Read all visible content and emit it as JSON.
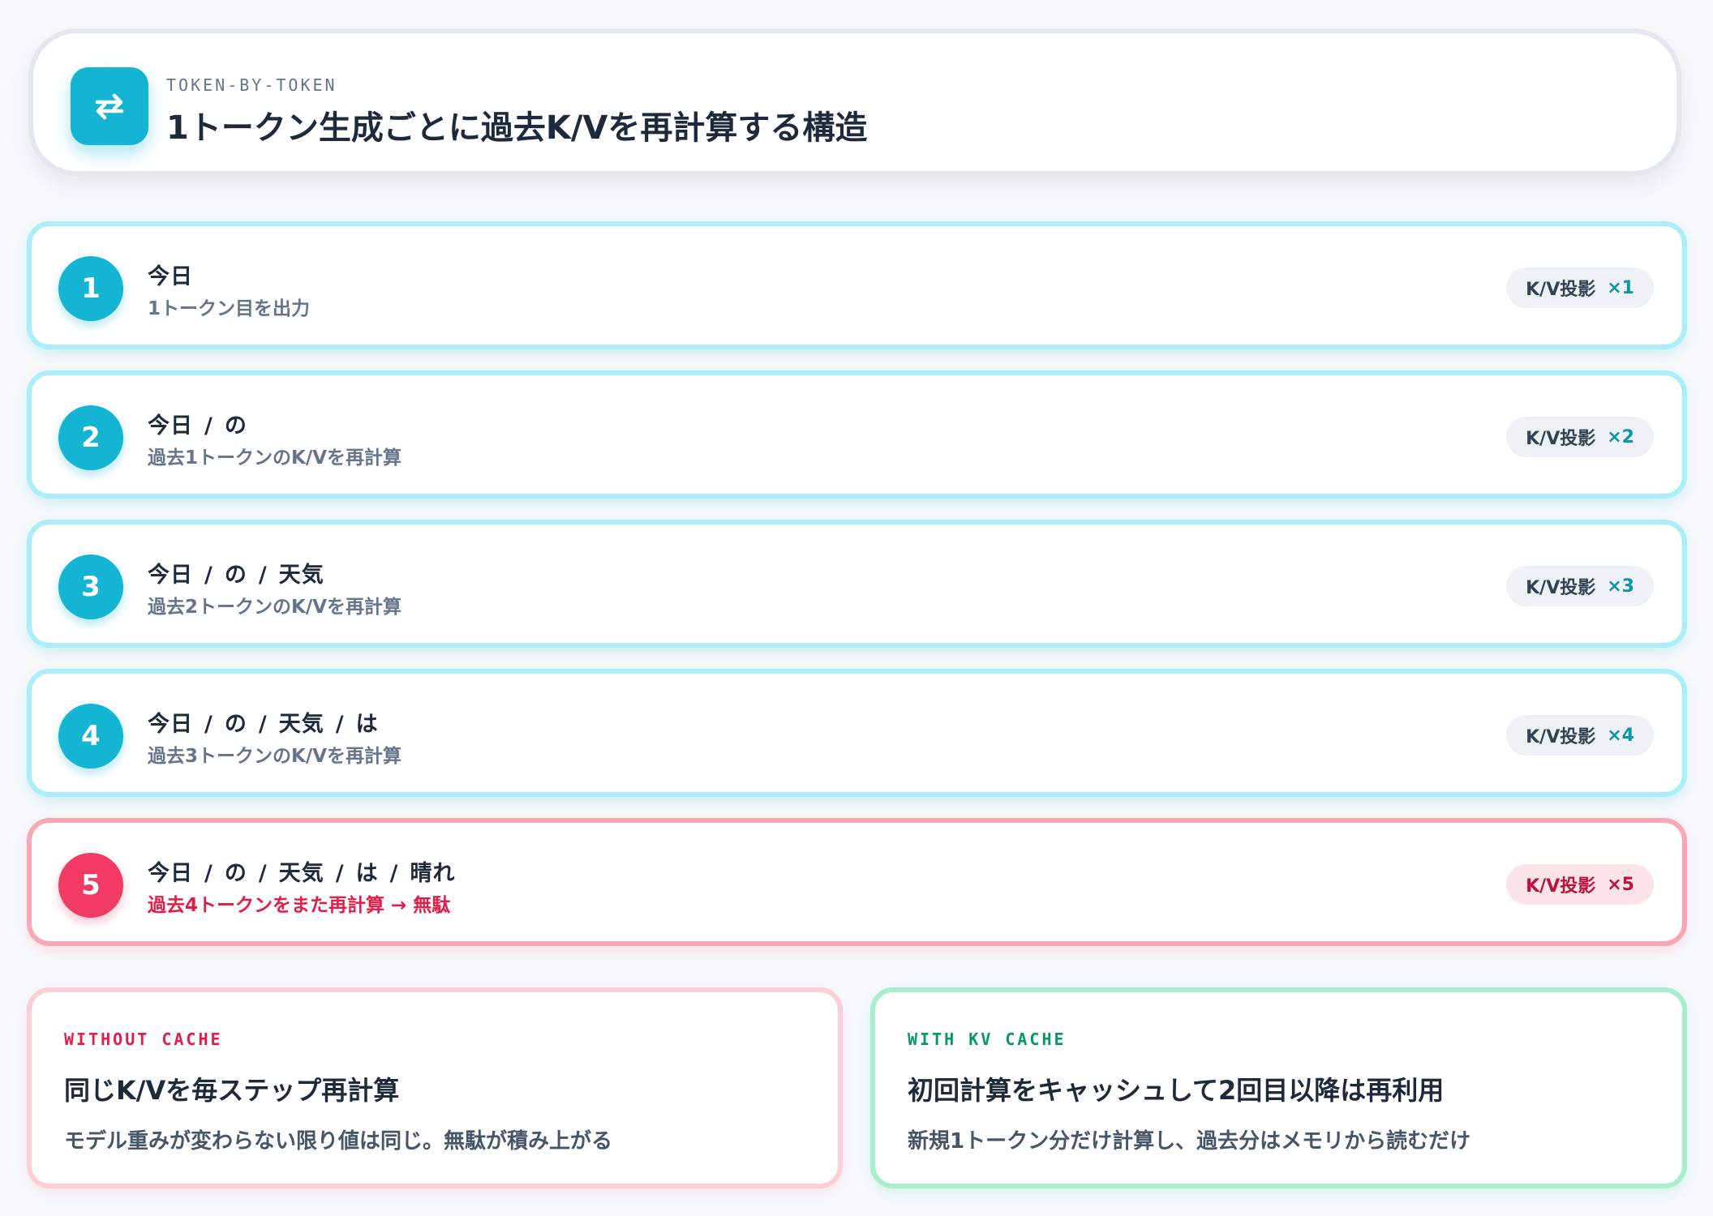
{
  "header": {
    "eyebrow": "TOKEN-BY-TOKEN",
    "title": "1トークン生成ごとに過去K/Vを再計算する構造",
    "icon": "repeat-arrows-icon",
    "accent": "#14b4d3"
  },
  "steps": [
    {
      "number": "1",
      "tokens": [
        "今日"
      ],
      "sub": "1トークン目を出力",
      "badge_label": "K/V投影",
      "badge_mult": "×1",
      "state": "normal"
    },
    {
      "number": "2",
      "tokens": [
        "今日",
        "の"
      ],
      "sub": "過去1トークンのK/Vを再計算",
      "badge_label": "K/V投影",
      "badge_mult": "×2",
      "state": "normal"
    },
    {
      "number": "3",
      "tokens": [
        "今日",
        "の",
        "天気"
      ],
      "sub": "過去2トークンのK/Vを再計算",
      "badge_label": "K/V投影",
      "badge_mult": "×3",
      "state": "normal"
    },
    {
      "number": "4",
      "tokens": [
        "今日",
        "の",
        "天気",
        "は"
      ],
      "sub": "過去3トークンのK/Vを再計算",
      "badge_label": "K/V投影",
      "badge_mult": "×4",
      "state": "normal"
    },
    {
      "number": "5",
      "tokens": [
        "今日",
        "の",
        "天気",
        "は",
        "晴れ"
      ],
      "sub": "過去4トークンをまた再計算 → 無駄",
      "badge_label": "K/V投影",
      "badge_mult": "×5",
      "state": "alert"
    }
  ],
  "token_separator": "/",
  "compare": {
    "without": {
      "eyebrow": "WITHOUT CACHE",
      "title": "同じK/Vを毎ステップ再計算",
      "desc": "モデル重みが変わらない限り値は同じ。無駄が積み上がる",
      "color": "#e11d48"
    },
    "with": {
      "eyebrow": "WITH KV CACHE",
      "title": "初回計算をキャッシュして2回目以降は再利用",
      "desc": "新規1トークン分だけ計算し、過去分はメモリから読むだけ",
      "color": "#059669"
    }
  }
}
